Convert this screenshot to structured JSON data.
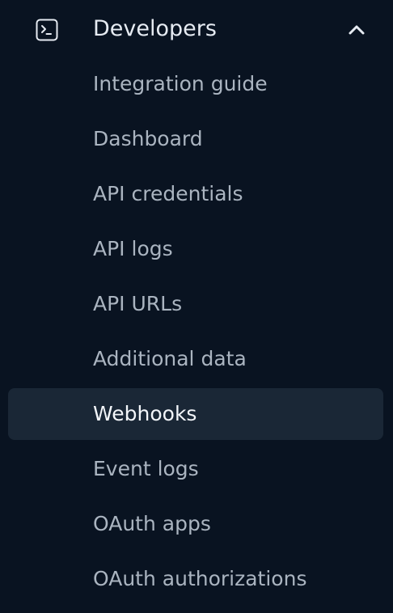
{
  "section": {
    "icon": "terminal-icon",
    "title": "Developers",
    "expanded_icon": "chevron-up-icon"
  },
  "menu": {
    "items": [
      {
        "label": "Integration guide",
        "active": false
      },
      {
        "label": "Dashboard",
        "active": false
      },
      {
        "label": "API credentials",
        "active": false
      },
      {
        "label": "API logs",
        "active": false
      },
      {
        "label": "API URLs",
        "active": false
      },
      {
        "label": "Additional data",
        "active": false
      },
      {
        "label": "Webhooks",
        "active": true
      },
      {
        "label": "Event logs",
        "active": false
      },
      {
        "label": "OAuth apps",
        "active": false
      },
      {
        "label": "OAuth authorizations",
        "active": false
      }
    ]
  },
  "colors": {
    "background": "#091321",
    "active_item_bg": "#1a2736",
    "text_primary": "#e6ebf2",
    "text_secondary": "#aab4c0"
  }
}
